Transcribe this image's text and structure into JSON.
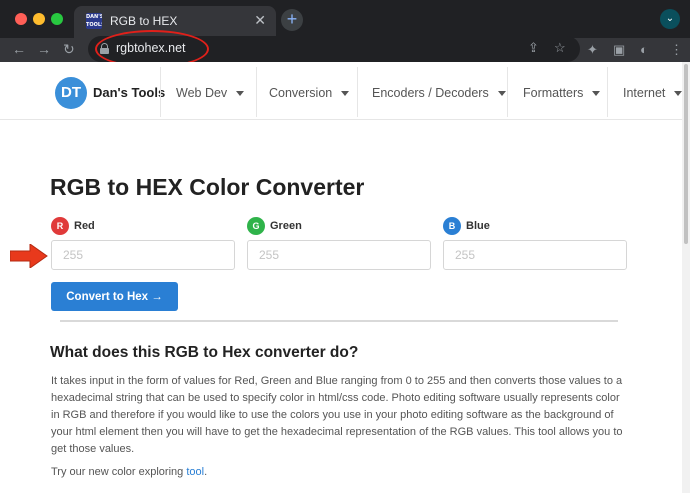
{
  "browser": {
    "tab_title": "RGB to HEX",
    "favicon_text": "DAN'S TOOLS",
    "close_glyph": "✕",
    "new_tab_glyph": "+",
    "url": "rgbtohex.net",
    "nav": {
      "back": "←",
      "forward": "→",
      "reload": "↻"
    },
    "toolbar_icons": {
      "share": "⇪",
      "star": "☆",
      "extensions": "✦",
      "sidepanel": "▣",
      "profile": "◐",
      "menu": "⋮"
    },
    "profile_glyph": "⌄"
  },
  "site": {
    "logo_initials": "DT",
    "brand": "Dan's Tools",
    "nav_items": [
      "Web Dev",
      "Conversion",
      "Encoders / Decoders",
      "Formatters",
      "Internet"
    ]
  },
  "converter": {
    "title": "RGB to HEX Color Converter",
    "fields": [
      {
        "badge": "R",
        "label": "Red",
        "placeholder": "255",
        "color": "#e03a3a"
      },
      {
        "badge": "G",
        "label": "Green",
        "placeholder": "255",
        "color": "#2fb34a"
      },
      {
        "badge": "B",
        "label": "Blue",
        "placeholder": "255",
        "color": "#2a7fd4"
      }
    ],
    "button_label": "Convert to Hex →"
  },
  "about": {
    "heading": "What does this RGB to Hex converter do?",
    "paragraph": "It takes input in the form of values for Red, Green and Blue ranging from 0 to 255 and then converts those values to a hexadecimal string that can be used to specify color in html/css code. Photo editing software usually represents color in RGB and therefore if you would like to use the colors you use in your photo editing software as the background of your html element then you will have to get the hexadecimal representation of the RGB values. This tool allows you to get those values.",
    "try_text": "Try our new color exploring ",
    "try_link": "tool",
    "try_end": "."
  },
  "annotations": {
    "highlight_color": "#e0201a",
    "arrow_color": "#e8391c"
  }
}
